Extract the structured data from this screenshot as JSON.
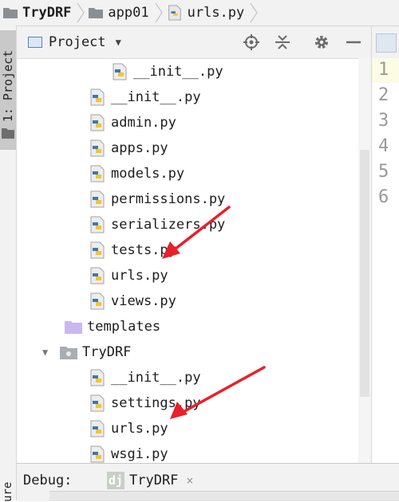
{
  "breadcrumb": [
    {
      "label": "TryDRF",
      "bold": true,
      "icon": "folder-icon"
    },
    {
      "label": "app01",
      "bold": false,
      "icon": "folder-icon"
    },
    {
      "label": "urls.py",
      "bold": false,
      "icon": "python-file-icon"
    }
  ],
  "left_strip": {
    "project_tab": "1: Project",
    "structure_tab": "ure"
  },
  "project_panel": {
    "title": "Project",
    "icons": [
      "locate-icon",
      "collapse-icon",
      "gear-icon",
      "minimize-icon"
    ]
  },
  "tree": [
    {
      "label": "__init__.py",
      "type": "python"
    },
    {
      "label": "__init__.py",
      "type": "python"
    },
    {
      "label": "admin.py",
      "type": "python"
    },
    {
      "label": "apps.py",
      "type": "python"
    },
    {
      "label": "models.py",
      "type": "python"
    },
    {
      "label": "permissions.py",
      "type": "python"
    },
    {
      "label": "serializers.py",
      "type": "python"
    },
    {
      "label": "tests.py",
      "type": "python"
    },
    {
      "label": "urls.py",
      "type": "python"
    },
    {
      "label": "views.py",
      "type": "python"
    },
    {
      "label": "templates",
      "type": "folder",
      "color": "#c9b8f0"
    },
    {
      "label": "TryDRF",
      "type": "package",
      "expanded": true
    },
    {
      "label": "__init__.py",
      "type": "python"
    },
    {
      "label": "settings.py",
      "type": "python"
    },
    {
      "label": "urls.py",
      "type": "python"
    },
    {
      "label": "wsgi.py",
      "type": "python"
    }
  ],
  "editor": {
    "line_numbers": [
      "1",
      "2",
      "3",
      "4",
      "5",
      "6"
    ]
  },
  "debug": {
    "label": "Debug:",
    "tab_icon": "dj",
    "tab_label": "TryDRF",
    "close": "×"
  },
  "colors": {
    "accent_arrow": "#e8202a",
    "python_blue": "#3d78b0",
    "python_yellow": "#f0c72f"
  }
}
